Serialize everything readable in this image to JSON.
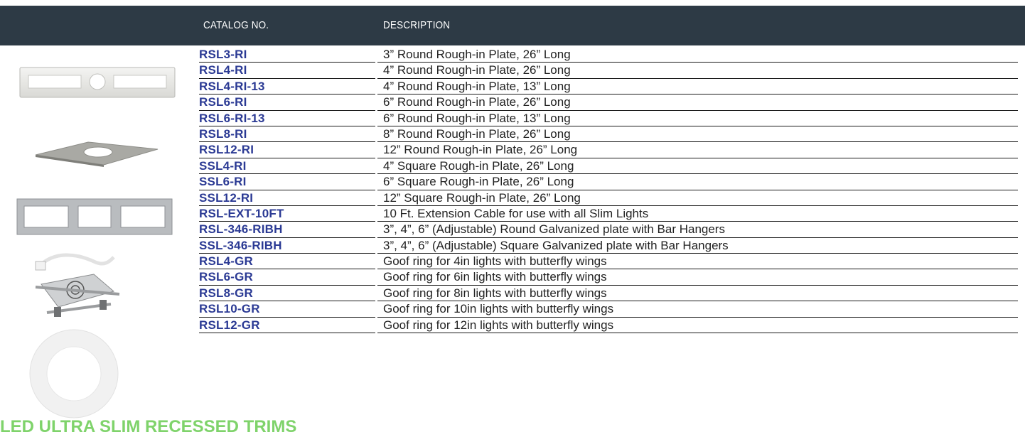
{
  "table": {
    "headers": {
      "catalog": "CATALOG NO.",
      "description": "DESCRIPTION"
    },
    "rows": [
      {
        "catalog": "RSL3-RI",
        "description": "3” Round Rough-in Plate, 26” Long"
      },
      {
        "catalog": "RSL4-RI",
        "description": "4” Round Rough-in Plate, 26” Long"
      },
      {
        "catalog": "RSL4-RI-13",
        "description": "4” Round Rough-in Plate, 13” Long"
      },
      {
        "catalog": "RSL6-RI",
        "description": "6” Round Rough-in Plate, 26” Long"
      },
      {
        "catalog": "RSL6-RI-13",
        "description": "6” Round Rough-in Plate, 13” Long"
      },
      {
        "catalog": "RSL8-RI",
        "description": "8” Round Rough-in Plate, 26” Long"
      },
      {
        "catalog": "RSL12-RI",
        "description": "12” Round Rough-in Plate, 26” Long"
      },
      {
        "catalog": "SSL4-RI",
        "description": "4” Square Rough-in Plate, 26” Long"
      },
      {
        "catalog": "SSL6-RI",
        "description": "6” Square Rough-in Plate, 26” Long"
      },
      {
        "catalog": "SSL12-RI",
        "description": "12” Square Rough-in Plate, 26” Long"
      },
      {
        "catalog": "RSL-EXT-10FT",
        "description": "10 Ft. Extension Cable for use with all Slim Lights"
      },
      {
        "catalog": "RSL-346-RIBH",
        "description": "3”, 4”, 6” (Adjustable) Round Galvanized plate with Bar Hangers"
      },
      {
        "catalog": "SSL-346-RIBH",
        "description": "3”, 4”, 6” (Adjustable) Square Galvanized plate with Bar Hangers"
      },
      {
        "catalog": "RSL4-GR",
        "description": "Goof ring for 4in lights with butterfly wings"
      },
      {
        "catalog": "RSL6-GR",
        "description": "Goof ring for 6in lights with butterfly wings"
      },
      {
        "catalog": "RSL8-GR",
        "description": "Goof ring for 8in lights with butterfly wings"
      },
      {
        "catalog": "RSL10-GR",
        "description": "Goof ring for 10in lights with butterfly wings"
      },
      {
        "catalog": "RSL12-GR",
        "description": "Goof ring for 12in lights with butterfly wings"
      }
    ]
  },
  "footer": {
    "partial_heading": "LED ULTRA SLIM RECESSED TRIMS"
  },
  "colors": {
    "header_bg": "#2d3a45",
    "catalog_text": "#2b3a94",
    "footer_heading": "#7fd36b"
  },
  "images": [
    "round-rough-in-plate-icon",
    "round-rough-in-plate-angled-icon",
    "square-rough-in-plate-icon",
    "bar-hanger-kit-with-cable-icon",
    "goof-ring-icon"
  ]
}
